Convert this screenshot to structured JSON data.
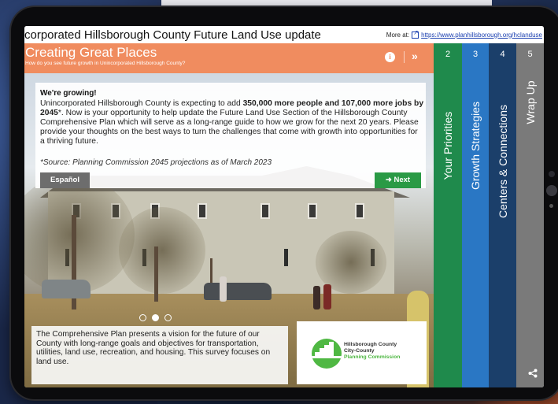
{
  "page": {
    "title": "corporated Hillsborough County Future Land Use update",
    "more_label": "More at:",
    "more_link": "https://www.planhillsborough.org/hclanduse"
  },
  "header": {
    "title": "Creating Great Places",
    "subtitle": "How do you see future growth in Unincorporated Hillsborough County?",
    "info_icon": "info-icon",
    "next_icon": "double-chevron-right-icon"
  },
  "intro": {
    "heading": "We're growing!",
    "body_1": "Unincorporated Hillsborough County is expecting to add ",
    "body_bold": "350,000 more people and 107,000 more jobs by 2045",
    "body_2": "*. Now is your opportunity to help update the Future Land Use Section of the Hillsborough County Comprehensive Plan which will serve as a long-range guide to how we grow for the next 20 years. Please provide your thoughts on the best ways to turn the challenges that come with growth into opportunities for a thriving future.",
    "source": "*Source: Planning Commission 2045 projections as of March 2023",
    "spanish_button": "Español",
    "next_button": "Next"
  },
  "carousel": {
    "pages": 3,
    "active": 2
  },
  "comp_plan_text": "The Comprehensive Plan presents a vision for the future of our County with long-range goals and objectives for transportation, utilities, land use, recreation, and housing. This survey focuses on land use.",
  "logo": {
    "line1": "Hillsborough County",
    "line2": "City-County",
    "line3": "Planning Commission"
  },
  "tabs": [
    {
      "number": "2",
      "label": "Your Priorities",
      "color": "#1f8a4c"
    },
    {
      "number": "3",
      "label": "Growth Strategies",
      "color": "#2a77c4"
    },
    {
      "number": "4",
      "label": "Centers & Connections",
      "color": "#1b3f6a"
    },
    {
      "number": "5",
      "label": "Wrap Up",
      "color": "#7a7a7a"
    }
  ],
  "colors": {
    "header_bg": "#f08c5f",
    "next_button": "#2a9a45",
    "spanish_button": "#6d6d6d",
    "logo_green": "#4fb843"
  }
}
